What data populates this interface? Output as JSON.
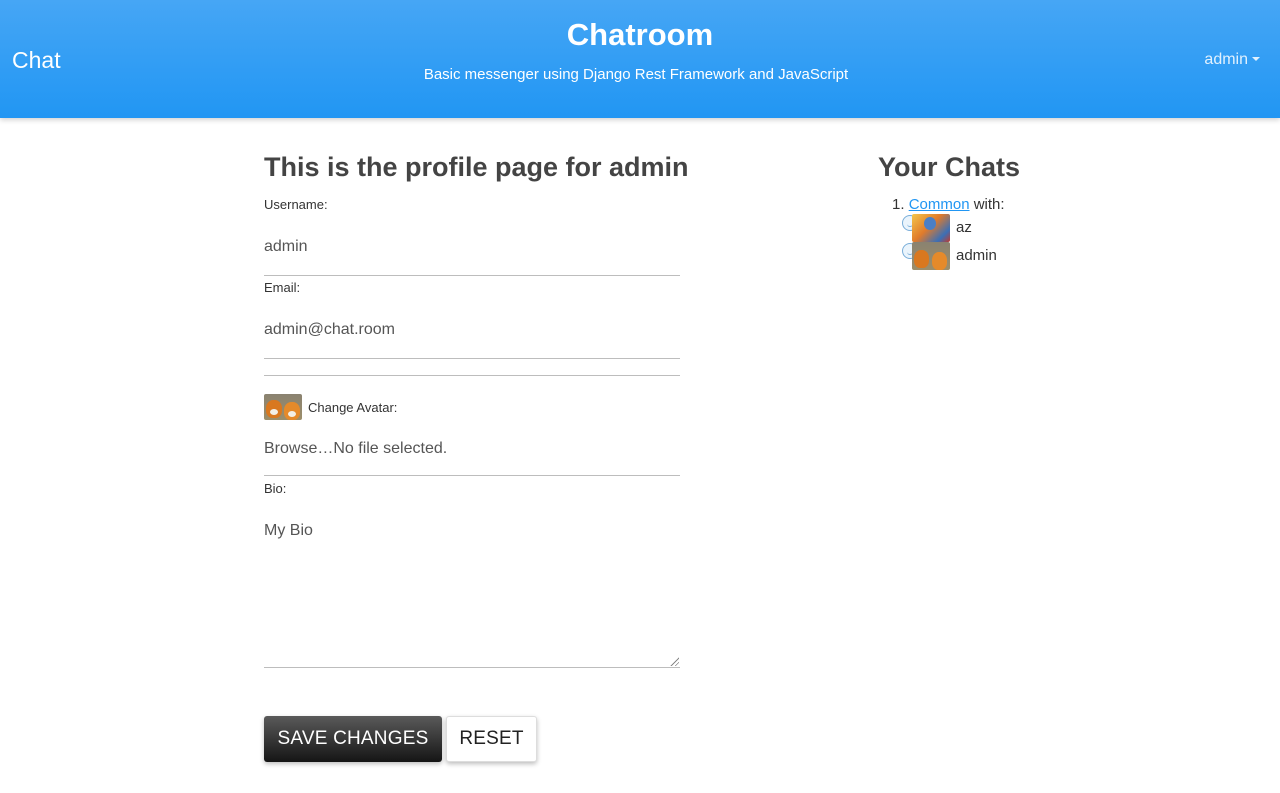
{
  "header": {
    "brand": "Chat",
    "title": "Chatroom",
    "subtitle": "Basic messenger using Django Rest Framework and JavaScript",
    "user_menu": "admin"
  },
  "profile": {
    "heading": "This is the profile page for admin",
    "username_label": "Username:",
    "username_value": "admin",
    "email_label": "Email:",
    "email_value": "admin@chat.room",
    "avatar_label": "Change Avatar:",
    "file_input_text": "Browse…No file selected.",
    "bio_label": "Bio:",
    "bio_value": "My Bio",
    "save_label": "SAVE CHANGES",
    "reset_label": "RESET"
  },
  "chats": {
    "heading": "Your Chats",
    "items": [
      {
        "index": "1.",
        "name": "Common",
        "with_text": "with:",
        "members": [
          {
            "name": "az"
          },
          {
            "name": "admin"
          }
        ]
      }
    ]
  },
  "colors": {
    "header_gradient_top": "#46a6f5",
    "header_gradient_bottom": "#2196f3",
    "link": "#2196f3",
    "save_button": "#1f1f1f"
  }
}
